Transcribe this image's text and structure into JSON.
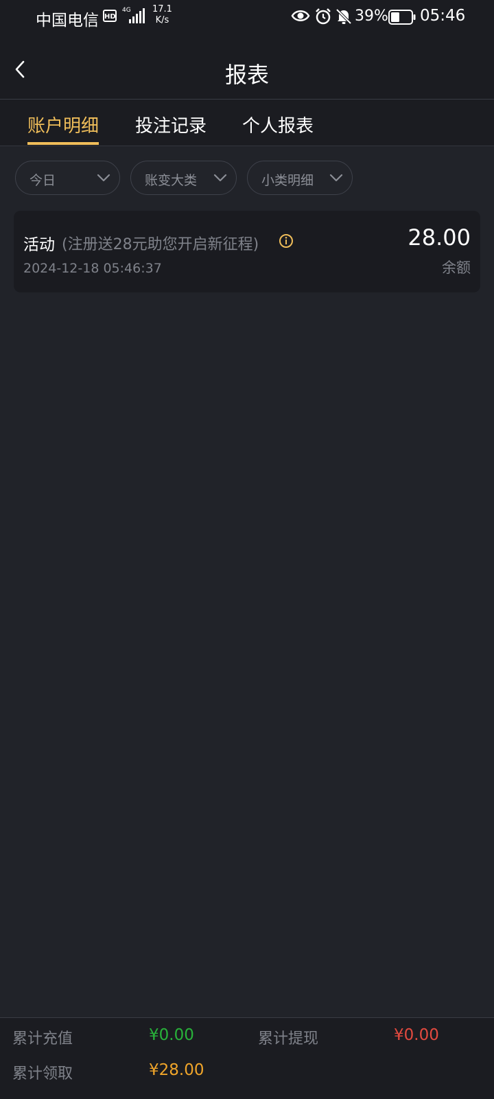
{
  "status_bar": {
    "carrier": "中国电信",
    "hd": "HD",
    "network": "4G",
    "speed_value": "17.1",
    "speed_unit": "K/s",
    "battery": "39%",
    "time": "05:46"
  },
  "header": {
    "title": "报表"
  },
  "tabs": [
    {
      "label": "账户明细",
      "active": true
    },
    {
      "label": "投注记录",
      "active": false
    },
    {
      "label": "个人报表",
      "active": false
    }
  ],
  "filters": [
    {
      "label": "今日"
    },
    {
      "label": "账变大类"
    },
    {
      "label": "小类明细"
    }
  ],
  "records": [
    {
      "title": "活动",
      "note": "(注册送28元助您开启新征程)",
      "date": "2024-12-18 05:46:37",
      "amount": "28.00",
      "amount_label": "余额"
    }
  ],
  "summary": {
    "total_deposit_label": "累计充值",
    "total_deposit_value": "¥0.00",
    "total_withdraw_label": "累计提现",
    "total_withdraw_value": "¥0.00",
    "total_claimed_label": "累计领取",
    "total_claimed_value": "¥28.00"
  },
  "colors": {
    "accent": "#f0be5a",
    "deposit": "#28b23a",
    "withdraw": "#e34a3f",
    "claimed": "#f0a52a",
    "background": "#212329"
  }
}
